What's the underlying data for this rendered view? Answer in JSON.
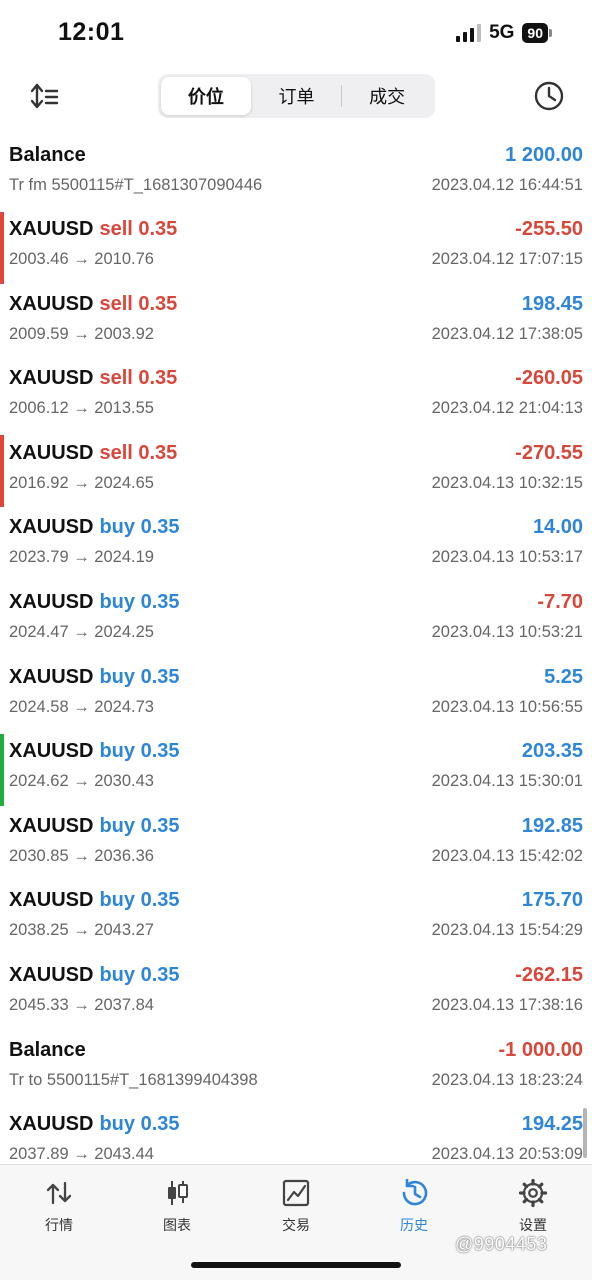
{
  "status": {
    "time": "12:01",
    "network": "5G",
    "battery": "90"
  },
  "segments": [
    {
      "label": "价位",
      "active": true
    },
    {
      "label": "订单",
      "active": false
    },
    {
      "label": "成交",
      "active": false
    }
  ],
  "rows": [
    {
      "type": "balance",
      "title": "Balance",
      "amount": "1 200.00",
      "sign": "pos",
      "sub": "Tr fm 5500115#T_1681307090446",
      "time": "2023.04.12 16:44:51",
      "marker": ""
    },
    {
      "type": "trade",
      "symbol": "XAUUSD",
      "side": "sell 0.35",
      "side_type": "sell",
      "amount": "-255.50",
      "sign": "neg",
      "prices": "2003.46 → 2010.76",
      "time": "2023.04.12 17:07:15",
      "marker": "#e0473c"
    },
    {
      "type": "trade",
      "symbol": "XAUUSD",
      "side": "sell 0.35",
      "side_type": "sell",
      "amount": "198.45",
      "sign": "pos",
      "prices": "2009.59 → 2003.92",
      "time": "2023.04.12 17:38:05",
      "marker": ""
    },
    {
      "type": "trade",
      "symbol": "XAUUSD",
      "side": "sell 0.35",
      "side_type": "sell",
      "amount": "-260.05",
      "sign": "neg",
      "prices": "2006.12 → 2013.55",
      "time": "2023.04.12 21:04:13",
      "marker": ""
    },
    {
      "type": "trade",
      "symbol": "XAUUSD",
      "side": "sell 0.35",
      "side_type": "sell",
      "amount": "-270.55",
      "sign": "neg",
      "prices": "2016.92 → 2024.65",
      "time": "2023.04.13 10:32:15",
      "marker": "#e0473c"
    },
    {
      "type": "trade",
      "symbol": "XAUUSD",
      "side": "buy 0.35",
      "side_type": "buy",
      "amount": "14.00",
      "sign": "pos",
      "prices": "2023.79 → 2024.19",
      "time": "2023.04.13 10:53:17",
      "marker": ""
    },
    {
      "type": "trade",
      "symbol": "XAUUSD",
      "side": "buy 0.35",
      "side_type": "buy",
      "amount": "-7.70",
      "sign": "neg",
      "prices": "2024.47 → 2024.25",
      "time": "2023.04.13 10:53:21",
      "marker": ""
    },
    {
      "type": "trade",
      "symbol": "XAUUSD",
      "side": "buy 0.35",
      "side_type": "buy",
      "amount": "5.25",
      "sign": "pos",
      "prices": "2024.58 → 2024.73",
      "time": "2023.04.13 10:56:55",
      "marker": ""
    },
    {
      "type": "trade",
      "symbol": "XAUUSD",
      "side": "buy 0.35",
      "side_type": "buy",
      "amount": "203.35",
      "sign": "pos",
      "prices": "2024.62 → 2030.43",
      "time": "2023.04.13 15:30:01",
      "marker": "#1fae3b"
    },
    {
      "type": "trade",
      "symbol": "XAUUSD",
      "side": "buy 0.35",
      "side_type": "buy",
      "amount": "192.85",
      "sign": "pos",
      "prices": "2030.85 → 2036.36",
      "time": "2023.04.13 15:42:02",
      "marker": ""
    },
    {
      "type": "trade",
      "symbol": "XAUUSD",
      "side": "buy 0.35",
      "side_type": "buy",
      "amount": "175.70",
      "sign": "pos",
      "prices": "2038.25 → 2043.27",
      "time": "2023.04.13 15:54:29",
      "marker": ""
    },
    {
      "type": "trade",
      "symbol": "XAUUSD",
      "side": "buy 0.35",
      "side_type": "buy",
      "amount": "-262.15",
      "sign": "neg",
      "prices": "2045.33 → 2037.84",
      "time": "2023.04.13 17:38:16",
      "marker": ""
    },
    {
      "type": "balance",
      "title": "Balance",
      "amount": "-1 000.00",
      "sign": "neg",
      "sub": "Tr to 5500115#T_1681399404398",
      "time": "2023.04.13 18:23:24",
      "marker": ""
    },
    {
      "type": "trade",
      "symbol": "XAUUSD",
      "side": "buy 0.35",
      "side_type": "buy",
      "amount": "194.25",
      "sign": "pos",
      "prices": "2037.89 → 2043.44",
      "time": "2023.04.13 20:53:09",
      "marker": ""
    }
  ],
  "nav": [
    {
      "label": "行情",
      "icon": "quotes-arrows-icon",
      "active": false
    },
    {
      "label": "图表",
      "icon": "candlestick-chart-icon",
      "active": false
    },
    {
      "label": "交易",
      "icon": "trade-chart-icon",
      "active": false
    },
    {
      "label": "历史",
      "icon": "history-clock-icon",
      "active": true
    },
    {
      "label": "设置",
      "icon": "settings-gear-icon",
      "active": false
    }
  ],
  "watermark": "@9904453",
  "colors": {
    "accent": "#2f86d8",
    "loss": "#d9473b",
    "sell_marker": "#e0473c",
    "buy_marker": "#1fae3b"
  }
}
